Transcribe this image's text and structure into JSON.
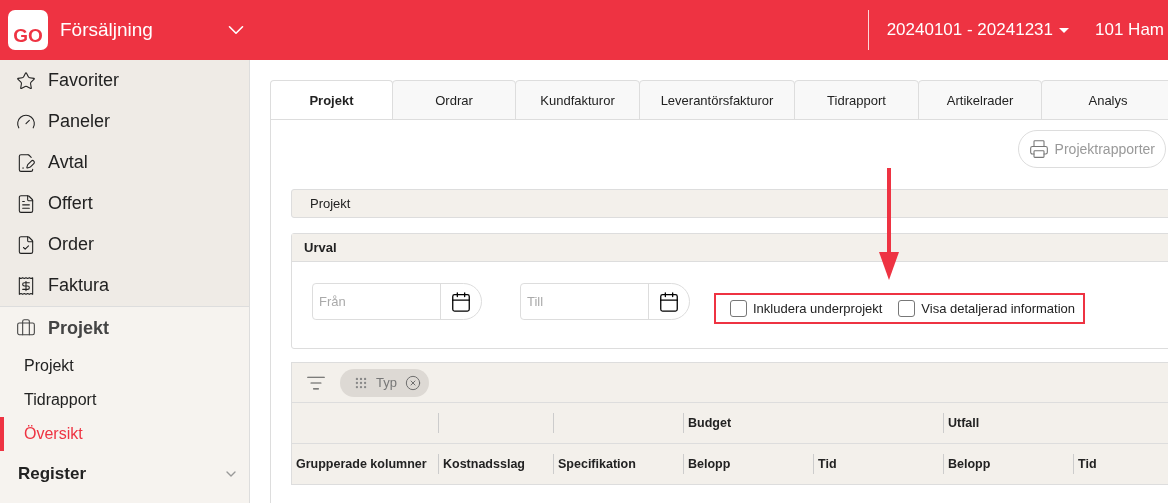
{
  "header": {
    "logo": "GO",
    "module": "Försäljning",
    "period": "20240101 - 20241231",
    "company": "101 Ham"
  },
  "sidebar": {
    "items": [
      {
        "label": "Favoriter"
      },
      {
        "label": "Paneler"
      },
      {
        "label": "Avtal"
      },
      {
        "label": "Offert"
      },
      {
        "label": "Order"
      },
      {
        "label": "Faktura"
      }
    ],
    "section": {
      "label": "Projekt",
      "children": [
        {
          "label": "Projekt",
          "selected": false
        },
        {
          "label": "Tidrapport",
          "selected": false
        },
        {
          "label": "Översikt",
          "selected": true
        }
      ]
    },
    "register": {
      "label": "Register",
      "expanded": false
    }
  },
  "tabs": [
    {
      "label": "Projekt",
      "selected": true
    },
    {
      "label": "Ordrar",
      "selected": false
    },
    {
      "label": "Kundfakturor",
      "selected": false
    },
    {
      "label": "Leverantörsfakturor",
      "selected": false
    },
    {
      "label": "Tidrapport",
      "selected": false
    },
    {
      "label": "Artikelrader",
      "selected": false
    },
    {
      "label": "Analys",
      "selected": false
    }
  ],
  "report_button": "Projektrapporter",
  "project_bar": "Projekt",
  "selection": {
    "title": "Urval",
    "from": {
      "placeholder": "Från"
    },
    "to": {
      "placeholder": "Till"
    },
    "highlighted": true,
    "arrow": true,
    "checkboxes": [
      {
        "label": "Inkludera underprojekt",
        "checked": false
      },
      {
        "label": "Visa detaljerad information",
        "checked": false
      }
    ]
  },
  "grid": {
    "group_chip": "Typ",
    "group_headers": [
      {
        "label": "Budget"
      },
      {
        "label": "Utfall"
      }
    ],
    "columns": [
      "Grupperade kolumner",
      "Kostnadsslag",
      "Specifikation",
      "Belopp",
      "Tid",
      "Belopp",
      "Tid"
    ]
  }
}
